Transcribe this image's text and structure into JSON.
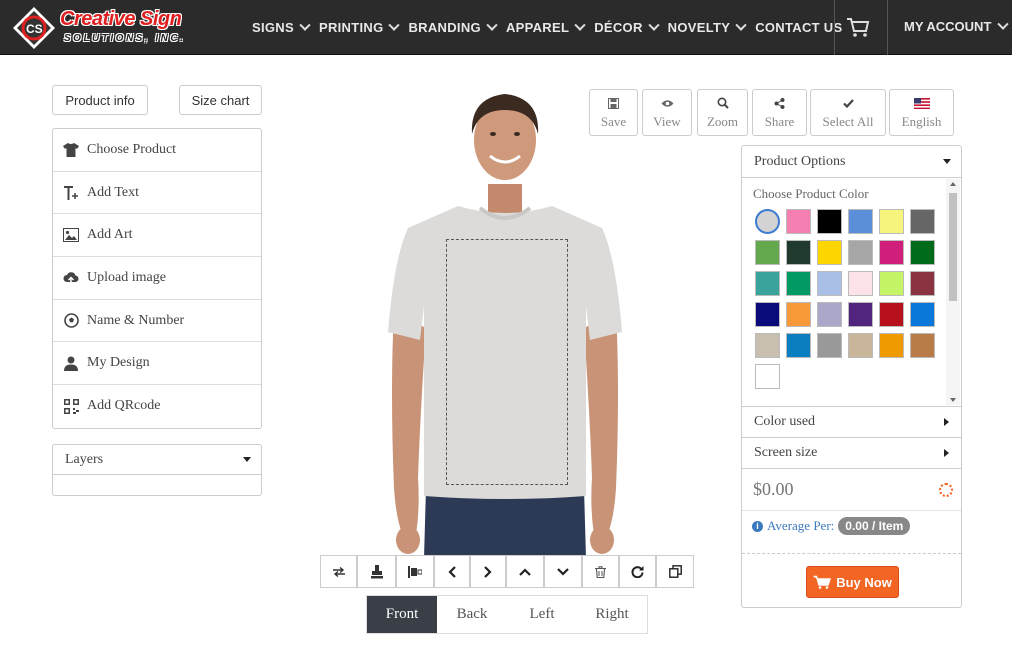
{
  "header": {
    "logo_line1": "Creative Sign",
    "logo_line2": "SOLUTIONS, INC.",
    "nav": [
      "SIGNS",
      "PRINTING",
      "BRANDING",
      "APPAREL",
      "DÉCOR",
      "NOVELTY",
      "CONTACT US"
    ],
    "account": "MY ACCOUNT"
  },
  "top_buttons": {
    "product_info": "Product info",
    "size_chart": "Size chart"
  },
  "menu": [
    {
      "label": "Choose Product",
      "icon": "tshirt-icon"
    },
    {
      "label": "Add Text",
      "icon": "text-add-icon"
    },
    {
      "label": "Add Art",
      "icon": "image-icon"
    },
    {
      "label": "Upload image",
      "icon": "cloud-upload-icon"
    },
    {
      "label": "Name & Number",
      "icon": "soccer-ball-icon"
    },
    {
      "label": "My Design",
      "icon": "user-icon"
    },
    {
      "label": "Add QRcode",
      "icon": "qrcode-icon"
    }
  ],
  "layers": {
    "label": "Layers"
  },
  "tools": {
    "save": "Save",
    "view": "View",
    "zoom": "Zoom",
    "share": "Share",
    "select_all": "Select All",
    "language": "English"
  },
  "options": {
    "title": "Product Options",
    "color_label": "Choose Product Color",
    "colors": [
      "#d3d3d3",
      "#f57fb0",
      "#000000",
      "#5b8fd9",
      "#f7f47e",
      "#666666",
      "#64a84e",
      "#213a2e",
      "#fdd500",
      "#a6a6a6",
      "#cf1f7a",
      "#006b1a",
      "#3aa39c",
      "#009a62",
      "#a9bfe8",
      "#fde3e8",
      "#c3f566",
      "#8a3340",
      "#0a0a7a",
      "#f99a3a",
      "#aaa8c8",
      "#51257e",
      "#b5101c",
      "#0a78d8",
      "#c9bfb0",
      "#0a7ebf",
      "#999999",
      "#c9b59a",
      "#ef9a00",
      "#b97b47",
      "#ffffff"
    ],
    "selected_color": "#d3d3d3",
    "color_used": "Color used",
    "screen_size": "Screen size",
    "price": "$0.00",
    "average_label": "Average Per:",
    "average_value": "0.00 / Item",
    "buy_now": "Buy Now"
  },
  "views": {
    "front": "Front",
    "back": "Back",
    "left": "Left",
    "right": "Right",
    "active": "Front"
  }
}
